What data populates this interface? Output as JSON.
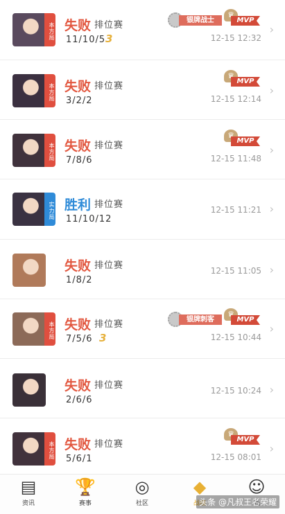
{
  "matches": [
    {
      "result": "失败",
      "type": "lose",
      "mode": "排位赛",
      "kda": "11/10/5",
      "triple": "3",
      "badge": "本方局",
      "badge_color": "red",
      "avatar_icon": "hero-portrait-icon",
      "silver": "银牌战士",
      "mvp": "MVP",
      "time": "12-15 12:32"
    },
    {
      "result": "失败",
      "type": "lose",
      "mode": "排位赛",
      "kda": "3/2/2",
      "triple": "",
      "badge": "本方局",
      "badge_color": "red",
      "avatar_icon": "hero-portrait-icon",
      "silver": "",
      "mvp": "MVP",
      "time": "12-15 12:14"
    },
    {
      "result": "失败",
      "type": "lose",
      "mode": "排位赛",
      "kda": "7/8/6",
      "triple": "",
      "badge": "本方局",
      "badge_color": "red",
      "avatar_icon": "hero-portrait-icon",
      "silver": "",
      "mvp": "MVP",
      "time": "12-15 11:48"
    },
    {
      "result": "胜利",
      "type": "win",
      "mode": "排位赛",
      "kda": "11/10/12",
      "triple": "",
      "badge": "实力局",
      "badge_color": "blue",
      "avatar_icon": "hero-portrait-icon",
      "silver": "",
      "mvp": "",
      "time": "12-15 11:21"
    },
    {
      "result": "失败",
      "type": "lose",
      "mode": "排位赛",
      "kda": "1/8/2",
      "triple": "",
      "badge": "",
      "badge_color": "",
      "avatar_icon": "hero-portrait-icon",
      "silver": "",
      "mvp": "",
      "time": "12-15 11:05"
    },
    {
      "result": "失败",
      "type": "lose",
      "mode": "排位赛",
      "kda": "7/5/6",
      "triple": "3",
      "badge": "本方局",
      "badge_color": "red",
      "avatar_icon": "hero-portrait-icon",
      "silver": "银牌刺客",
      "mvp": "MVP",
      "time": "12-15 10:44"
    },
    {
      "result": "失败",
      "type": "lose",
      "mode": "排位赛",
      "kda": "2/6/6",
      "triple": "",
      "badge": "",
      "badge_color": "",
      "avatar_icon": "hero-portrait-icon",
      "silver": "",
      "mvp": "",
      "time": "12-15 10:24"
    },
    {
      "result": "失败",
      "type": "lose",
      "mode": "排位赛",
      "kda": "5/6/1",
      "triple": "",
      "badge": "本方局",
      "badge_color": "red",
      "avatar_icon": "hero-portrait-icon",
      "silver": "",
      "mvp": "MVP",
      "time": "12-15 08:01"
    }
  ],
  "nav": [
    {
      "label": "资讯",
      "icon": "news-icon",
      "active": false
    },
    {
      "label": "赛事",
      "icon": "trophy-icon",
      "active": false
    },
    {
      "label": "社区",
      "icon": "community-icon",
      "active": false
    },
    {
      "label": "战绩",
      "icon": "record-icon",
      "active": true
    },
    {
      "label": "我",
      "icon": "profile-icon",
      "active": false
    }
  ],
  "watermark": "头条 @凡叔王者荣耀",
  "colors": {
    "lose": "#e2573f",
    "win": "#2f8bd8",
    "accent": "#e8b034",
    "mvp_red": "#d34a38"
  }
}
